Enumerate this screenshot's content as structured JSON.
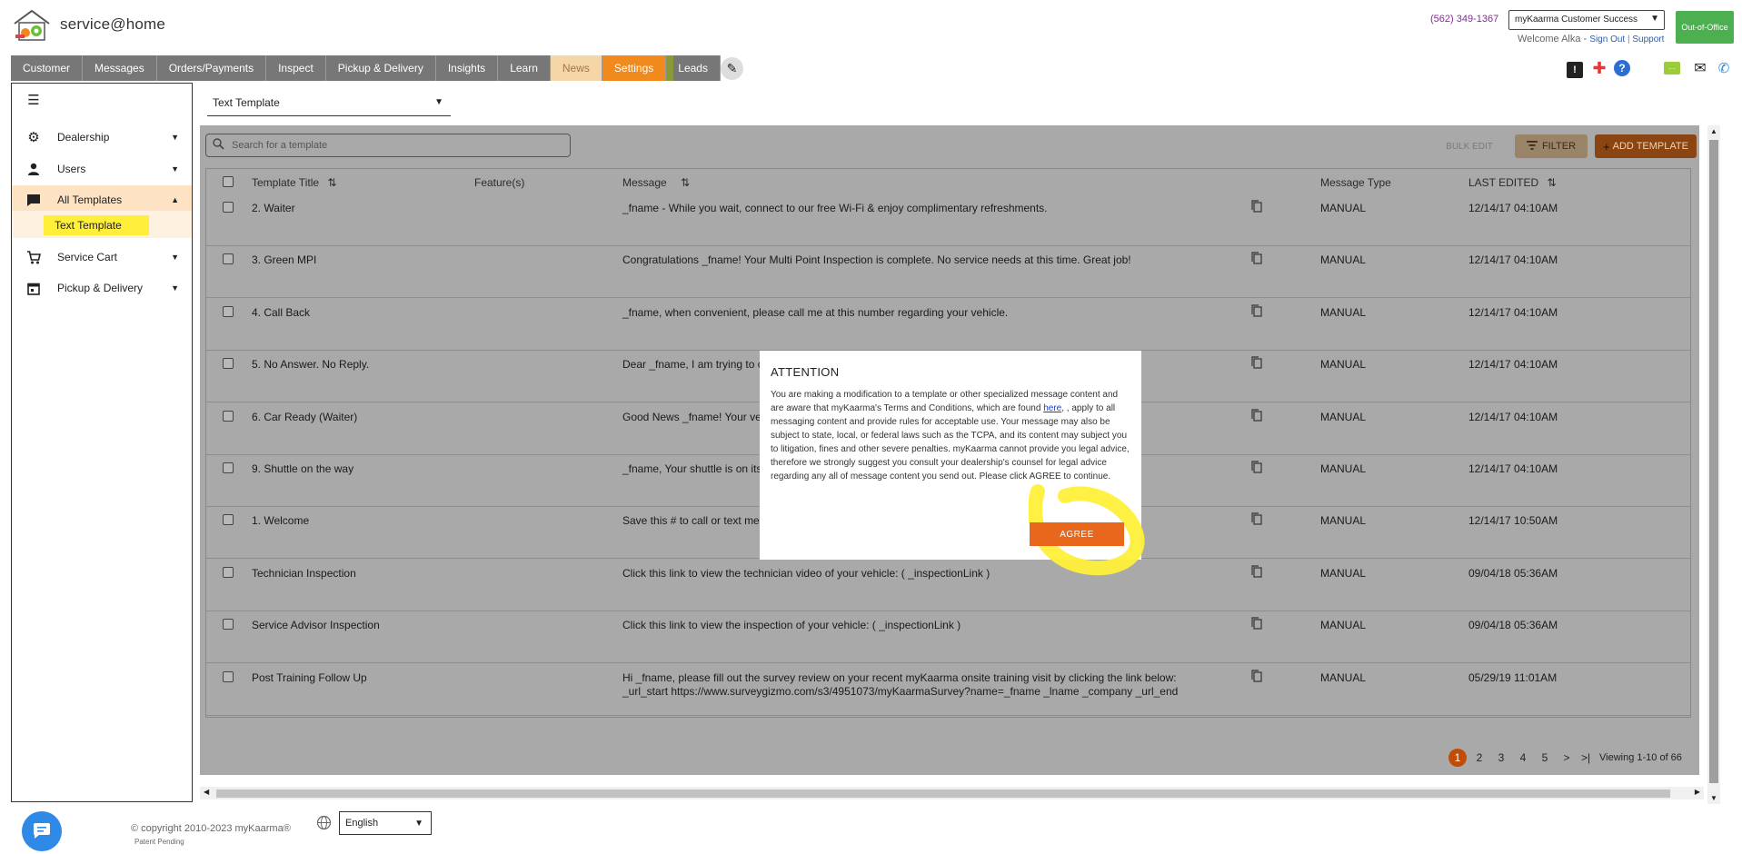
{
  "header": {
    "brand": "service@home",
    "phone": "(562) 349-1367",
    "account_select": "myKaarma Customer Success",
    "welcome": "Welcome Alka - ",
    "sign_out": "Sign Out",
    "separator": " | ",
    "support": "Support",
    "out_of_office": "Out-of-Office"
  },
  "nav": {
    "tabs": [
      "Customer",
      "Messages",
      "Orders/Payments",
      "Inspect",
      "Pickup & Delivery",
      "Insights",
      "Learn",
      "News",
      "Settings",
      "Leads"
    ]
  },
  "sidebar": {
    "items": [
      {
        "label": "Dealership",
        "icon": "gear-icon"
      },
      {
        "label": "Users",
        "icon": "user-icon"
      },
      {
        "label": "All Templates",
        "icon": "chat-icon"
      },
      {
        "label": "Service Cart",
        "icon": "cart-icon"
      },
      {
        "label": "Pickup & Delivery",
        "icon": "calendar-icon"
      }
    ],
    "sub_item": "Text Template"
  },
  "main": {
    "template_select": "Text Template",
    "search_placeholder": "Search for a template",
    "bulk_edit": "BULK EDIT",
    "filter": "FILTER",
    "add_template": "ADD TEMPLATE",
    "columns": {
      "title": "Template Title",
      "features": "Feature(s)",
      "message": "Message",
      "type": "Message Type",
      "edited": "LAST EDITED"
    },
    "rows": [
      {
        "title": "2. Waiter",
        "message": "_fname - While you wait, connect to our free Wi-Fi & enjoy complimentary refreshments.",
        "message2": "",
        "type": "MANUAL",
        "edited": "12/14/17 04:10AM"
      },
      {
        "title": "3. Green MPI",
        "message": "Congratulations _fname! Your Multi Point Inspection is complete. No service needs at this time. Great job!",
        "message2": "",
        "type": "MANUAL",
        "edited": "12/14/17 04:10AM"
      },
      {
        "title": "4. Call Back",
        "message": "_fname, when convenient, please call me at this number regarding your vehicle.",
        "message2": "",
        "type": "MANUAL",
        "edited": "12/14/17 04:10AM"
      },
      {
        "title": "5. No Answer. No Reply.",
        "message": "Dear _fname, I am trying to co",
        "message2": "",
        "type": "MANUAL",
        "edited": "12/14/17 04:10AM"
      },
      {
        "title": "6. Car Ready (Waiter)",
        "message": "Good News _fname! Your veh",
        "message2": "",
        "type": "MANUAL",
        "edited": "12/14/17 04:10AM"
      },
      {
        "title": "9. Shuttle on the way",
        "message": "_fname, Your shuttle is on its",
        "message2": "",
        "type": "MANUAL",
        "edited": "12/14/17 04:10AM"
      },
      {
        "title": "1. Welcome",
        "message": "Save this # to call or text me. S",
        "message2": "",
        "type": "MANUAL",
        "edited": "12/14/17 10:50AM"
      },
      {
        "title": "Technician Inspection",
        "message": "Click this link to view the technician video of your vehicle: ( _inspectionLink )",
        "message2": "",
        "type": "MANUAL",
        "edited": "09/04/18 05:36AM"
      },
      {
        "title": "Service Advisor Inspection",
        "message": "Click this link to view the inspection of your vehicle: ( _inspectionLink )",
        "message2": "",
        "type": "MANUAL",
        "edited": "09/04/18 05:36AM"
      },
      {
        "title": "Post Training Follow Up",
        "message": "Hi _fname, please fill out the survey review on your recent myKaarma onsite training visit by clicking the link below:",
        "message2": "_url_start https://www.surveygizmo.com/s3/4951073/myKaarmaSurvey?name=_fname _lname _company _url_end",
        "type": "MANUAL",
        "edited": "05/29/19 11:01AM"
      }
    ],
    "pagination": {
      "pages": [
        "1",
        "2",
        "3",
        "4",
        "5"
      ],
      "next": ">",
      "last": ">|",
      "viewing": "Viewing 1-10 of 66"
    }
  },
  "modal": {
    "title": "ATTENTION",
    "body_before": "You are making a modification to a template or other specialized message content and are aware that myKaarma's Terms and Conditions, which are found ",
    "link": "here",
    "body_after": ", , apply to all messaging content and provide rules for acceptable use. Your message may also be subject to state, local, or federal laws such as the TCPA, and its content may subject you to litigation, fines and other severe penalties. myKaarma cannot provide you legal advice, therefore we strongly suggest you consult your dealership's counsel for legal advice regarding any all of message content you send out. Please click AGREE to continue.",
    "agree": "AGREE"
  },
  "footer": {
    "copyright": "© copyright 2010-2023 myKaarma®",
    "patent": "Patent Pending",
    "language": "English"
  },
  "colors": {
    "accent": "#f08a1c",
    "agree": "#e9661d",
    "highlight": "#ffef3a",
    "ooo": "#4caf50"
  }
}
